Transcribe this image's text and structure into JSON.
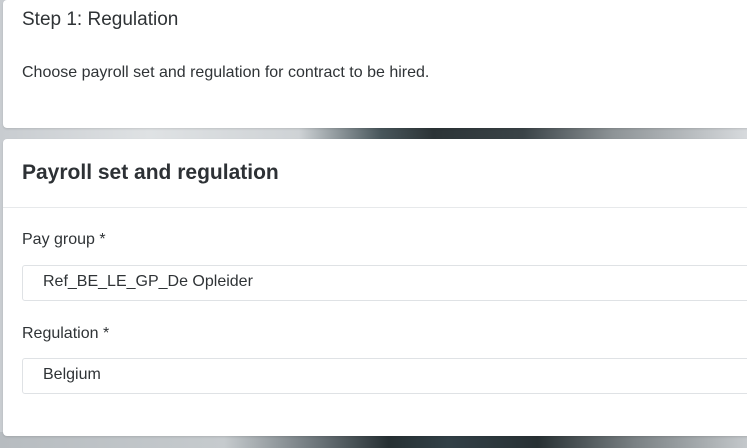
{
  "step": {
    "title": "Step 1: Regulation",
    "description": "Choose payroll set and regulation for contract to be hired."
  },
  "form": {
    "title": "Payroll set and regulation",
    "fields": [
      {
        "label": "Pay group *",
        "value": "Ref_BE_LE_GP_De Opleider"
      },
      {
        "label": "Regulation *",
        "value": "Belgium"
      }
    ]
  },
  "colors": {
    "card_background": "#ffffff",
    "text": "#2f3336",
    "border": "#dfe2e5"
  }
}
